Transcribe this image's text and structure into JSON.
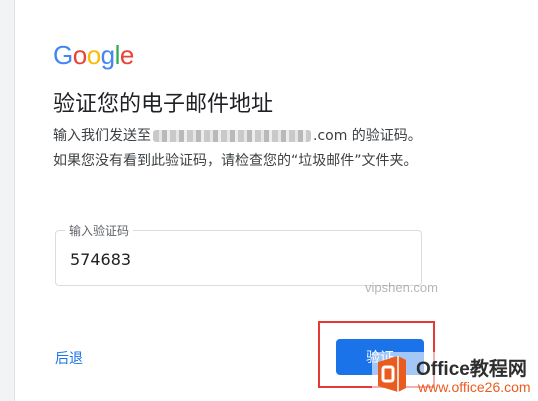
{
  "brand": {
    "logo_letters": [
      "G",
      "o",
      "o",
      "g",
      "l",
      "e"
    ],
    "logo_colors": [
      "#4285F4",
      "#EA4335",
      "#FBBC05",
      "#4285F4",
      "#34A853",
      "#EA4335"
    ]
  },
  "page": {
    "title": "验证您的电子邮件地址",
    "desc_prefix": "输入我们发送至",
    "desc_suffix": ".com 的验证码。如果您没有看到此验证码，请检查您的“垃圾邮件”文件夹。"
  },
  "field": {
    "label": "输入验证码",
    "value": "574683"
  },
  "actions": {
    "back_label": "后退",
    "verify_label": "验证"
  },
  "watermark": {
    "overlay_text": "vipshen.com",
    "brand_name": "Office教程网",
    "url": "www.office26.com",
    "accent_color": "#ea5b1f"
  }
}
